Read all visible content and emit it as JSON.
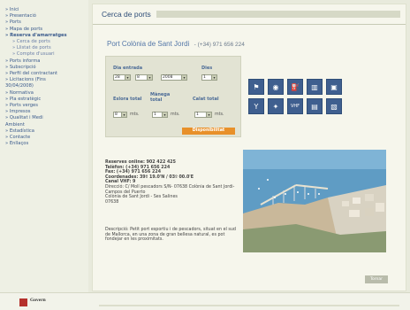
{
  "sidebar": {
    "items": [
      {
        "label": "» Inici",
        "bold": false,
        "sub": false
      },
      {
        "label": "» Presentació",
        "bold": false,
        "sub": false
      },
      {
        "label": "» Ports",
        "bold": false,
        "sub": false
      },
      {
        "label": "» Mapa de ports",
        "bold": false,
        "sub": false
      },
      {
        "label": "» Reserva d'amarratges",
        "bold": true,
        "sub": false
      },
      {
        "label": "» Cerca de ports",
        "bold": false,
        "sub": true
      },
      {
        "label": "» Llistat de ports",
        "bold": false,
        "sub": true
      },
      {
        "label": "» Compte d'usuari",
        "bold": false,
        "sub": true
      },
      {
        "label": "» Ports informa",
        "bold": false,
        "sub": false
      },
      {
        "label": "» Subscripció",
        "bold": false,
        "sub": false
      },
      {
        "label": "» Perfil del contractant",
        "bold": false,
        "sub": false
      },
      {
        "label": "» Licitacions (Fins",
        "bold": false,
        "sub": false
      },
      {
        "label": "30/04/2008)",
        "bold": false,
        "sub": false
      },
      {
        "label": "» Normativa",
        "bold": false,
        "sub": false
      },
      {
        "label": "» Pla estratègic",
        "bold": false,
        "sub": false
      },
      {
        "label": "» Ports verges",
        "bold": false,
        "sub": false
      },
      {
        "label": "» Impresos",
        "bold": false,
        "sub": false
      },
      {
        "label": "» Qualitat i Medi",
        "bold": false,
        "sub": false
      },
      {
        "label": "Ambient",
        "bold": false,
        "sub": false
      },
      {
        "label": "» Estadística",
        "bold": false,
        "sub": false
      },
      {
        "label": "» Contacte",
        "bold": false,
        "sub": false
      },
      {
        "label": "» Enllaços",
        "bold": false,
        "sub": false
      }
    ]
  },
  "header": {
    "title": "Cerca de ports"
  },
  "port": {
    "name": "Port Colònia de Sant Jordi",
    "phone": "- (+34) 971 656 224"
  },
  "form": {
    "day_label": "Dia entrada",
    "days_label": "Dies",
    "day_value": "28",
    "month_value": "8",
    "year_value": "2008",
    "days_value": "1",
    "eslora_label": "Eslora total",
    "manega_label": "Mànega total",
    "calat_label": "Calat total",
    "eslora_value": "8",
    "manega_value": "1",
    "calat_value": "1",
    "unit": "mts.",
    "submit_label": "Disponibilitat"
  },
  "icons": [
    "mooring-icon",
    "water-icon",
    "fuel-icon",
    "shower-icon",
    "waste-icon",
    "cocktail-icon",
    "wrench-icon",
    "vhf-radio-icon",
    "building-icon",
    "crane-icon"
  ],
  "icon_glyphs": [
    "⚑",
    "◉",
    "⛽",
    "▥",
    "▣",
    "Y",
    "✦",
    "VHF",
    "▤",
    "▧"
  ],
  "info": {
    "line1": "Reserves online: 902 422 425",
    "line2": "Telèfon: (+34) 971 656 224",
    "line3": "Fax: (+34) 971 656 224",
    "line4": "Coordenades: 39º 19.0'N / 03º 00.0'E",
    "line5": "Canal VHF: 9",
    "line6": "Direcció: C/ Moll pescadors S/N- 07638 Colònia de Sant Jordi-Campos del Puerto",
    "line7": "Colònia de Sant Jordi - Ses Salines",
    "line8": "07638"
  },
  "description": "Descripció: Petit port esportiu i de pescadors, situat en el sud de Mallorca, en una zona de gran bellesa natural, es pot fondejar en les proximitats.",
  "back_button": "Tornar",
  "footer": {
    "logo_text": "Govern"
  }
}
